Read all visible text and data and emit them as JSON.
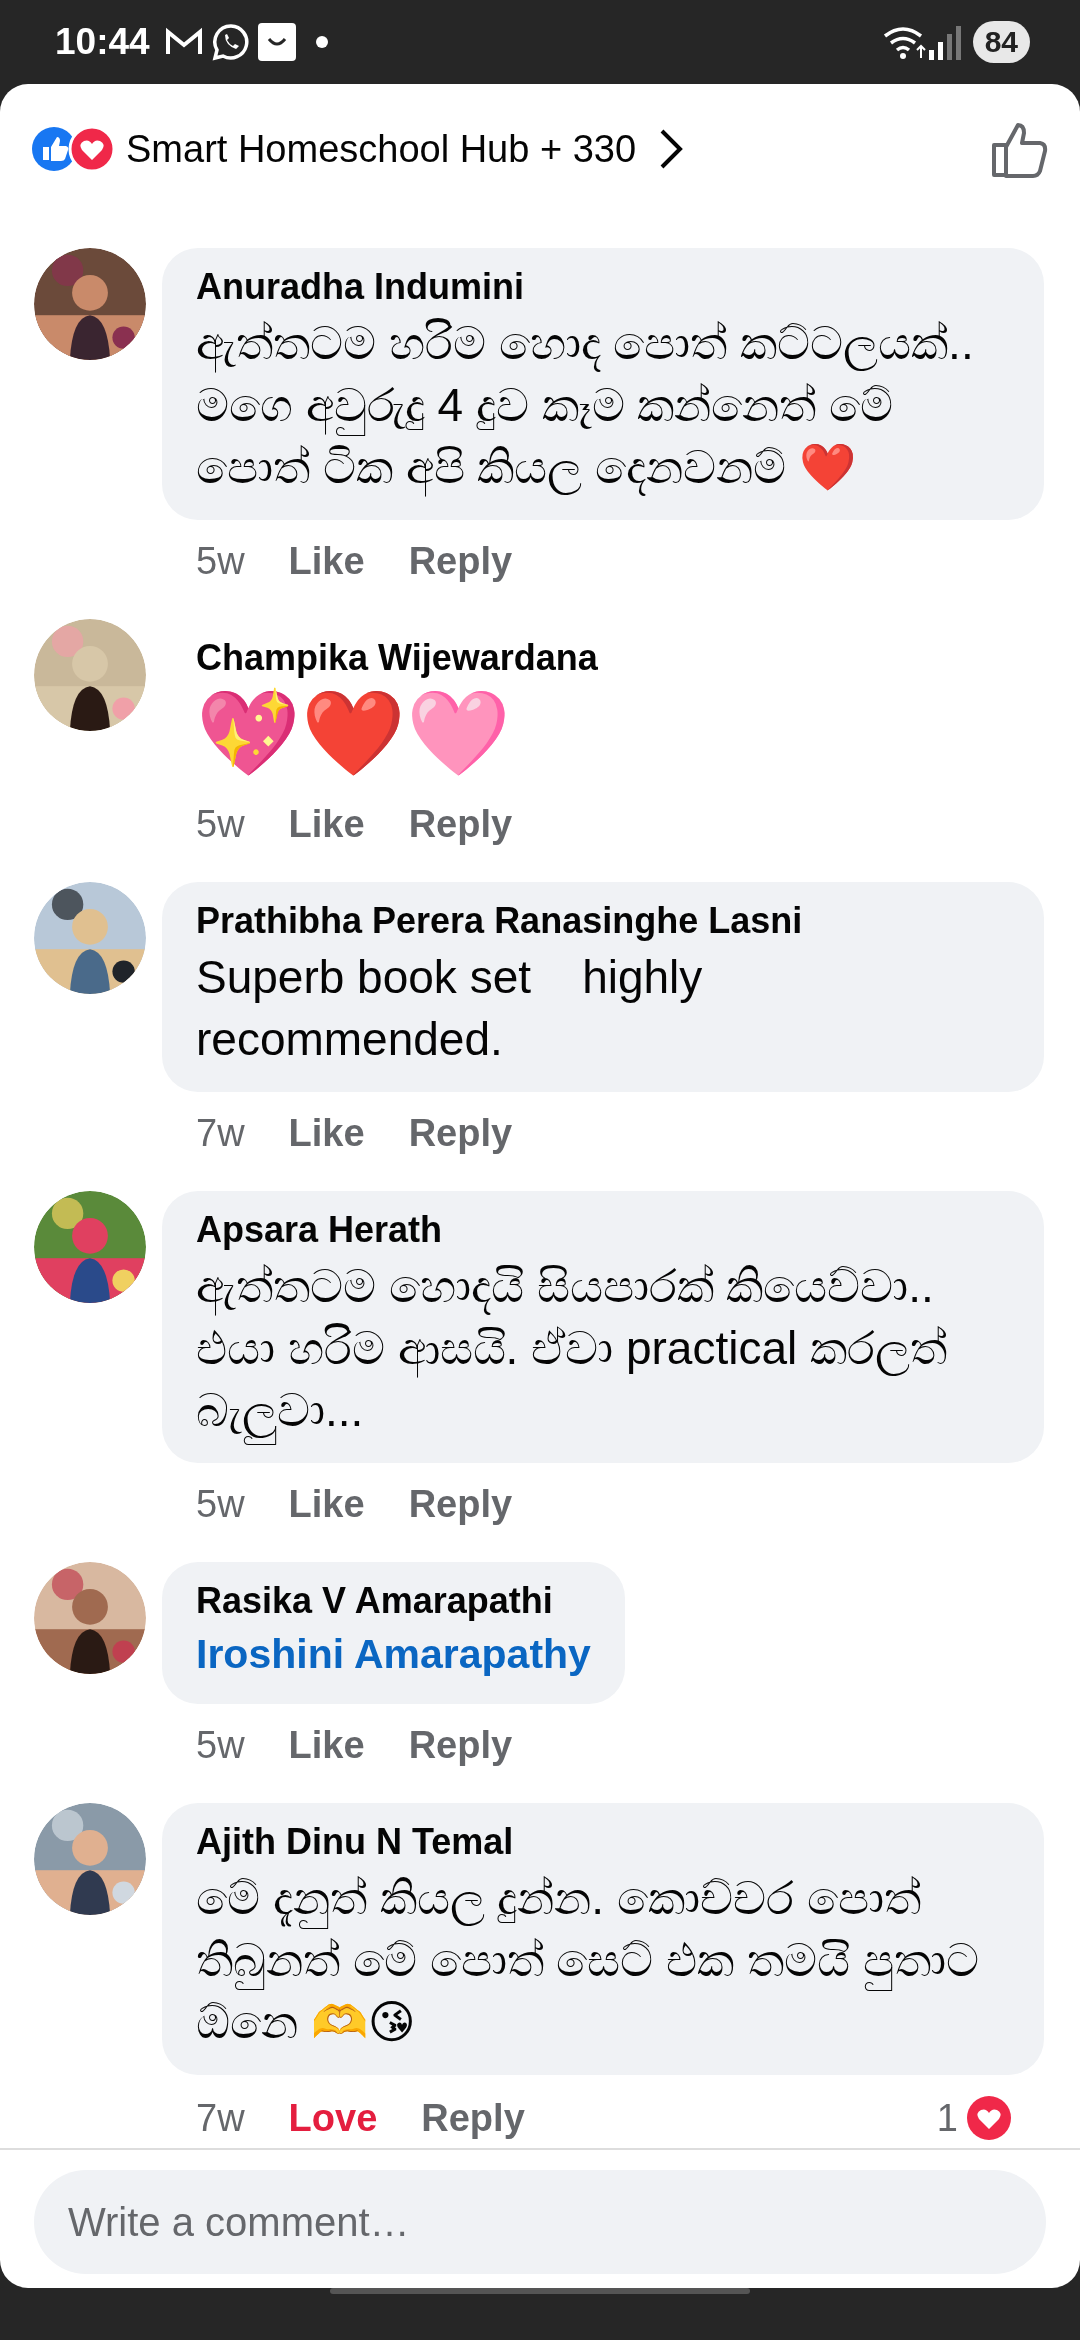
{
  "status_bar": {
    "time": "10:44",
    "battery": "84"
  },
  "header": {
    "title": "Smart Homeschool Hub + 330"
  },
  "comments": [
    {
      "kind": "bubble",
      "author": "Anuradha Indumini",
      "text": "ඇත්තටම හරිම හොද පොත් කට්ටලයක්.. මගෙ අවුරුදු 4 දුව කෑම කන්නෙත් මේ පොත් ටික අපි කියල දෙනවනම් ❤️",
      "time": "5w",
      "reaction_label": "Like",
      "reacted": false,
      "reply": "Reply"
    },
    {
      "kind": "emoji",
      "author": "Champika Wijewardana",
      "text": "💖❤️🩷",
      "time": "5w",
      "reaction_label": "Like",
      "reacted": false,
      "reply": "Reply"
    },
    {
      "kind": "bubble",
      "author": "Prathibha Perera Ranasinghe Lasni",
      "text": "Superb book set    highly recommended.",
      "time": "7w",
      "reaction_label": "Like",
      "reacted": false,
      "reply": "Reply"
    },
    {
      "kind": "bubble",
      "author": "Apsara Herath",
      "text": "ඇත්තටම හොදයි සියපාරක් කියෙව්වා.. එයා හරිම ආසයි. ඒවා practical කරලත් බැලුවා...",
      "time": "5w",
      "reaction_label": "Like",
      "reacted": false,
      "reply": "Reply"
    },
    {
      "kind": "mention",
      "author": "Rasika V Amarapathi",
      "text": "Iroshini Amarapathy",
      "time": "5w",
      "reaction_label": "Like",
      "reacted": false,
      "reply": "Reply"
    },
    {
      "kind": "bubble",
      "author": "Ajith Dinu N Temal",
      "text": "මේ දැනුත් කියල දුන්න. කොච්චර පොත් තිබුනත් මේ පොත් සෙට් එක තමයි පුතාට ඕනෙ 🫶😘",
      "time": "7w",
      "reaction_label": "Love",
      "reacted": true,
      "reply": "Reply",
      "reaction_count": "1"
    }
  ],
  "composer": {
    "placeholder": "Write a comment…"
  }
}
